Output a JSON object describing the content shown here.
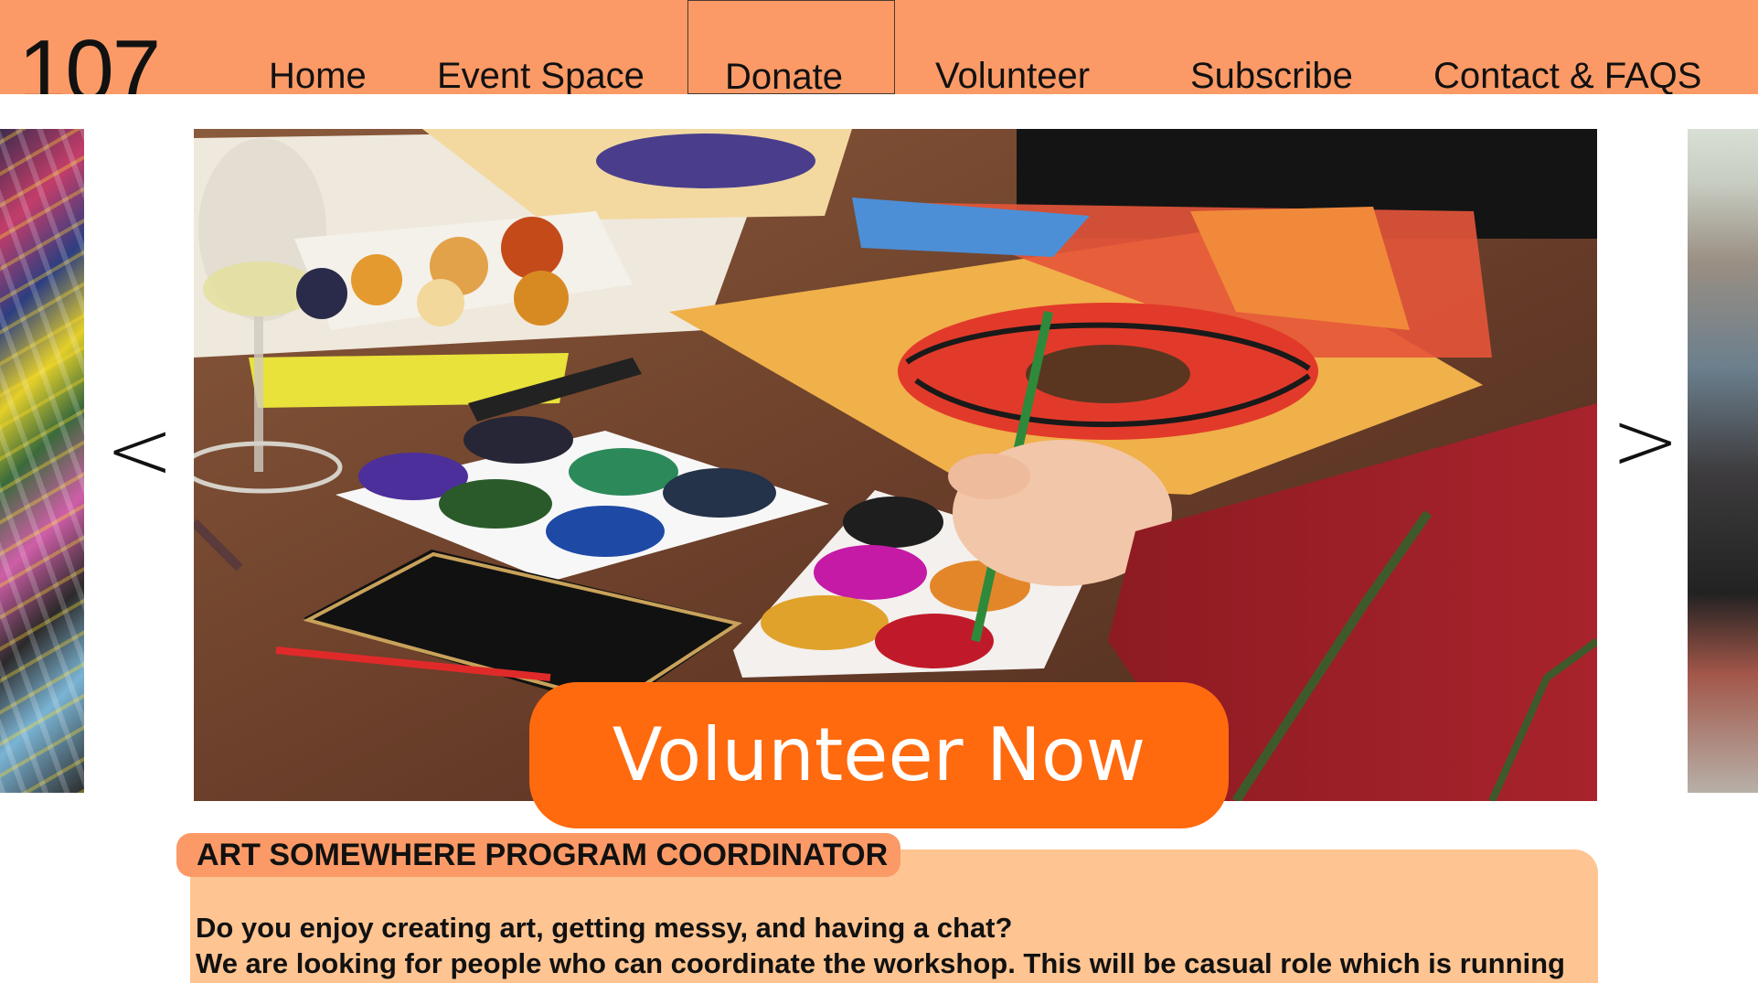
{
  "site": {
    "logo": "107"
  },
  "nav": {
    "items": [
      {
        "label": "Home"
      },
      {
        "label": "Event Space"
      },
      {
        "label": "Donate"
      },
      {
        "label": "Volunteer"
      },
      {
        "label": "Subscribe"
      },
      {
        "label": "Contact & FAQS"
      }
    ],
    "highlighted": "Donate"
  },
  "carousel": {
    "prev_glyph": "<",
    "next_glyph": ">",
    "cta_label": "Volunteer Now"
  },
  "role": {
    "title": "ART SOMEWHERE PROGRAM COORDINATOR",
    "lines": [
      "Do you enjoy creating art, getting messy, and having a chat?",
      "We are looking for people who can coordinate the workshop. This will be casual role which is running"
    ]
  },
  "colors": {
    "nav_bg": "#fb9a66",
    "cta_bg": "#ff6a0e",
    "panel_bg": "#fec492"
  }
}
